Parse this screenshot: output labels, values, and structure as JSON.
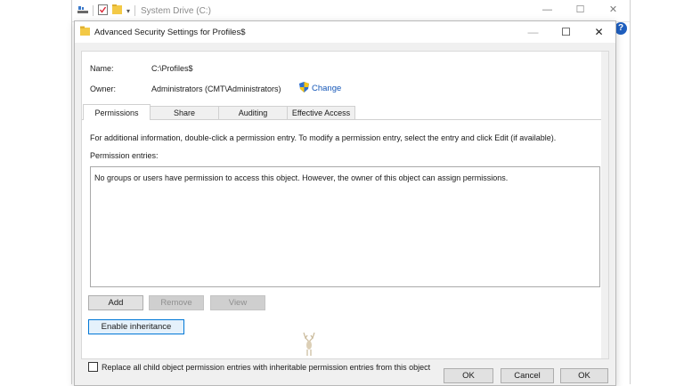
{
  "explorer": {
    "title": "System Drive (C:)",
    "window_controls": {
      "minimize": "—",
      "maximize": "☐",
      "close": "✕"
    }
  },
  "dialog": {
    "title": "Advanced Security Settings for Profiles$",
    "window_controls": {
      "minimize": "—",
      "maximize": "☐",
      "close": "✕"
    },
    "name_label": "Name:",
    "name_value": "C:\\Profiles$",
    "owner_label": "Owner:",
    "owner_value": "Administrators (CMT\\Administrators)",
    "change_link": "Change",
    "tabs": [
      {
        "label": "Permissions",
        "active": true
      },
      {
        "label": "Share",
        "active": false
      },
      {
        "label": "Auditing",
        "active": false
      },
      {
        "label": "Effective Access",
        "active": false
      }
    ],
    "info_text": "For additional information, double-click a permission entry. To modify a permission entry, select the entry and click Edit (if available).",
    "permission_entries_label": "Permission entries:",
    "empty_message": "No groups or users have permission to access this object. However, the owner of this object can assign permissions.",
    "buttons": {
      "add": "Add",
      "remove": "Remove",
      "view": "View",
      "enable_inheritance": "Enable inheritance"
    },
    "replace_checkbox_label": "Replace all child object permission entries with inheritable permission entries from this object",
    "replace_checkbox_checked": false,
    "footer": {
      "ok": "OK",
      "cancel": "Cancel",
      "apply": "OK"
    }
  },
  "help_icon": "?",
  "colors": {
    "link": "#1557b8",
    "focus": "#0078d7",
    "help": "#1f5fbf"
  },
  "icons": [
    "folder-icon",
    "properties-icon",
    "dropdown-icon",
    "shield-icon",
    "stag-logo-icon",
    "help-icon"
  ]
}
